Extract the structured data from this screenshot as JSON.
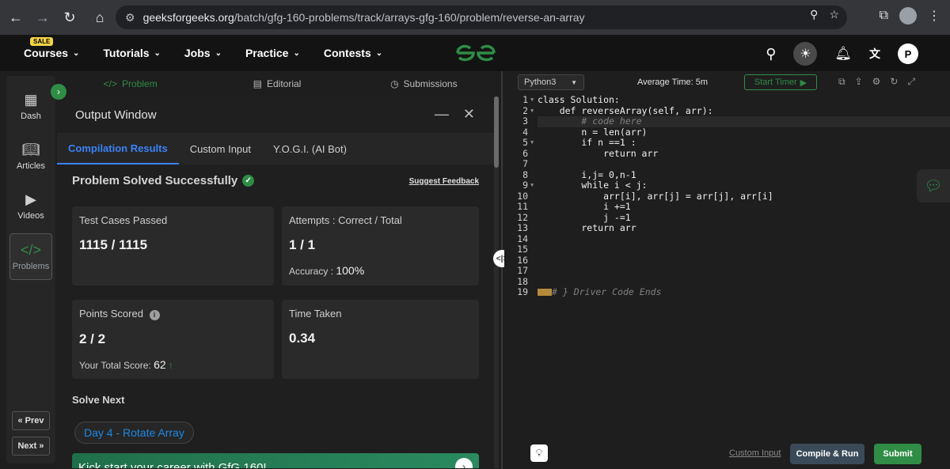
{
  "browser": {
    "url_host": "geeksforgeeks.org",
    "url_path": "/batch/gfg-160-problems/track/arrays-gfg-160/problem/reverse-an-array"
  },
  "site_nav": {
    "sale_badge": "SALE",
    "items": [
      "Courses",
      "Tutorials",
      "Jobs",
      "Practice",
      "Contests"
    ],
    "profile_initial": "P"
  },
  "left_rail": {
    "items": [
      "Dash",
      "Articles",
      "Videos",
      "Problems"
    ],
    "prev_label": "Prev",
    "next_label": "Next"
  },
  "problem_tabs": [
    "Problem",
    "Editorial",
    "Submissions"
  ],
  "output": {
    "title": "Output Window",
    "tabs": [
      "Compilation Results",
      "Custom Input",
      "Y.O.G.I. (AI Bot)"
    ],
    "status": "Problem Solved Successfully",
    "feedback_link": "Suggest Feedback",
    "test_cases_label": "Test Cases Passed",
    "test_cases_value": "1115 / 1115",
    "attempts_label": "Attempts : Correct / Total",
    "attempts_value": "1 / 1",
    "accuracy_label": "Accuracy :",
    "accuracy_value": "100%",
    "points_label": "Points Scored",
    "points_value": "2 / 2",
    "total_score_label": "Your Total Score:",
    "total_score_value": "62",
    "time_label": "Time Taken",
    "time_value": "0.34",
    "solve_next_label": "Solve Next",
    "next_problem": "Day 4 - Rotate Array",
    "banner_text": "Kick start your career with GfG 160!"
  },
  "editor": {
    "language": "Python3",
    "avg_time": "Average Time: 5m",
    "timer_label": "Start Timer",
    "line_numbers": [
      "1",
      "2",
      "3",
      "4",
      "5",
      "6",
      "7",
      "8",
      "9",
      "10",
      "11",
      "12",
      "13",
      "14",
      "15",
      "16",
      "17",
      "18",
      "19"
    ],
    "code_lines": [
      "class Solution:",
      "    def reverseArray(self, arr):",
      "        # code here",
      "        n = len(arr)",
      "        if n ==1 :",
      "            return arr",
      "",
      "        i,j= 0,n-1",
      "        while i < j:",
      "            arr[i], arr[j] = arr[j], arr[i]",
      "            i +=1",
      "            j -=1",
      "        return arr",
      "",
      "",
      "",
      "",
      "",
      "# } Driver Code Ends"
    ],
    "custom_input_link": "Custom Input",
    "compile_label": "Compile & Run",
    "submit_label": "Submit"
  }
}
